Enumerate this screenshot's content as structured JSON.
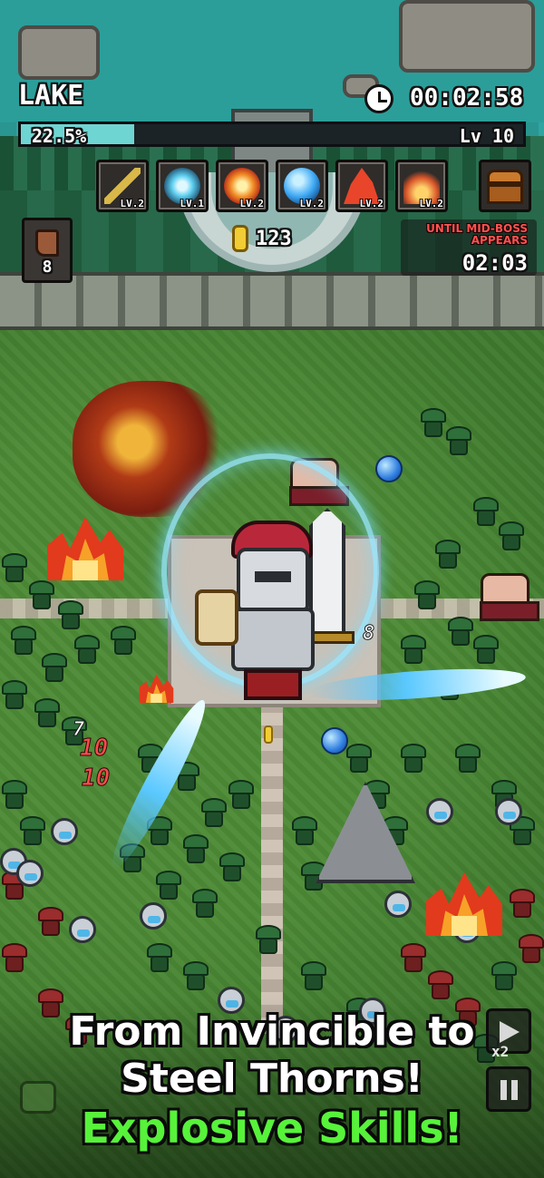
{
  "hud": {
    "stage_name": "LAKE",
    "clock_icon": "clock-icon",
    "elapsed_time": "00:02:58",
    "xp_percent_label": "22.5%",
    "xp_fraction": 0.225,
    "level_label": "Lv 10",
    "skills": [
      {
        "icon": "sword-icon",
        "level_label": "LV.2",
        "color": "#d9b84a"
      },
      {
        "icon": "lightning-orb-icon",
        "level_label": "LV.1",
        "color": "#5fd0f0"
      },
      {
        "icon": "fireball-icon",
        "level_label": "LV.2",
        "color": "#f08a24"
      },
      {
        "icon": "water-orb-icon",
        "level_label": "LV.2",
        "color": "#3fa9f5"
      },
      {
        "icon": "flame-icon",
        "level_label": "LV.2",
        "color": "#e8452a"
      },
      {
        "icon": "fire-burst-icon",
        "level_label": "LV.2",
        "color": "#d8552a"
      }
    ],
    "chest_icon": "treasure-chest-icon",
    "boot_item": {
      "icon": "boot-icon",
      "count": "8"
    },
    "coins": "123",
    "boss_notice": {
      "label_line1": "UNTIL MID-BOSS",
      "label_line2": "APPEARS",
      "countdown": "02:03"
    },
    "speed_button": {
      "icon": "fast-forward-icon",
      "label": "x2"
    },
    "pause_button": {
      "icon": "pause-icon"
    }
  },
  "battlefield": {
    "damage_numbers": [
      "7",
      "10",
      "10",
      "8"
    ]
  },
  "promo": {
    "line1": "From Invincible to",
    "line2": "Steel Thorns!",
    "line3": "Explosive Skills!"
  },
  "colors": {
    "promo_accent": "#57f23a",
    "boss_warning": "#ff5252",
    "xp_fill": "#6fd5d2"
  }
}
